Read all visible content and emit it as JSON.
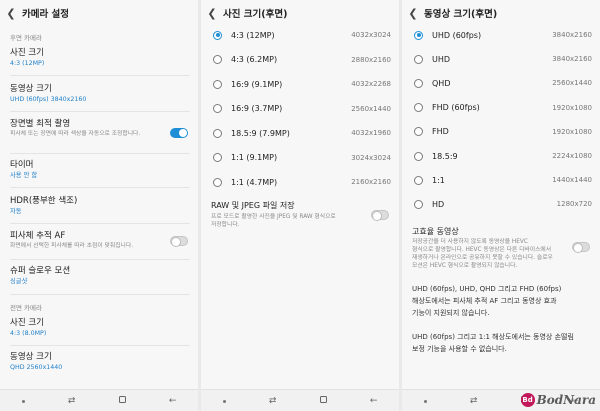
{
  "screen1": {
    "title": "카메라 설정",
    "rear_section": "후면 카메라",
    "front_section": "전면 카메라",
    "items": [
      {
        "title": "사진 크기",
        "sub": "4:3 (12MP)"
      },
      {
        "title": "동영상 크기",
        "sub": "UHD (60fps) 3840x2160"
      },
      {
        "title": "장면별 최적 촬영",
        "desc": "피사체 또는 장면에 따라 색상을 자동으로 조정합니다.",
        "toggle": true
      },
      {
        "title": "타이머",
        "sub": "사용 안 함"
      },
      {
        "title": "HDR(풍부한 색조)",
        "sub": "자동"
      },
      {
        "title": "피사체 추적 AF",
        "desc": "화면에서 선택한 피사체를 따라 초점이 맞춰집니다.",
        "toggle": false
      },
      {
        "title": "슈퍼 슬로우 모션",
        "sub": "싱글샷"
      }
    ],
    "front_items": [
      {
        "title": "사진 크기",
        "sub": "4:3 (8.0MP)"
      },
      {
        "title": "동영상 크기",
        "sub": "QHD 2560x1440"
      }
    ]
  },
  "screen2": {
    "title": "사진 크기(후면)",
    "options": [
      {
        "label": "4:3 (12MP)",
        "res": "4032x3024",
        "selected": true
      },
      {
        "label": "4:3 (6.2MP)",
        "res": "2880x2160",
        "selected": false
      },
      {
        "label": "16:9 (9.1MP)",
        "res": "4032x2268",
        "selected": false
      },
      {
        "label": "16:9 (3.7MP)",
        "res": "2560x1440",
        "selected": false
      },
      {
        "label": "18.5:9 (7.9MP)",
        "res": "4032x1960",
        "selected": false
      },
      {
        "label": "1:1 (9.1MP)",
        "res": "3024x3024",
        "selected": false
      },
      {
        "label": "1:1 (4.7MP)",
        "res": "2160x2160",
        "selected": false
      }
    ],
    "raw_title": "RAW 및 JPEG 파일 저장",
    "raw_desc_1": "프로 모드로 촬영한 사진을 JPEG 및 RAW 형식으로",
    "raw_desc_2": "저장합니다."
  },
  "screen3": {
    "title": "동영상 크기(후면)",
    "options": [
      {
        "label": "UHD (60fps)",
        "res": "3840x2160",
        "selected": true
      },
      {
        "label": "UHD",
        "res": "3840x2160",
        "selected": false
      },
      {
        "label": "QHD",
        "res": "2560x1440",
        "selected": false
      },
      {
        "label": "FHD (60fps)",
        "res": "1920x1080",
        "selected": false
      },
      {
        "label": "FHD",
        "res": "1920x1080",
        "selected": false
      },
      {
        "label": "18.5:9",
        "res": "2224x1080",
        "selected": false
      },
      {
        "label": "1:1",
        "res": "1440x1440",
        "selected": false
      },
      {
        "label": "HD",
        "res": "1280x720",
        "selected": false
      }
    ],
    "hevc_title": "고효율 동영상",
    "hevc_desc": [
      "저장공간을 더 사용하지 않도록 동영상을 HEVC",
      "형식으로 촬영합니다. HEVC 동영상은 다른 디바이스에서",
      "재생하거나 온라인으로 공유하지 못할 수 있습니다. 슬로우",
      "모션은 HEVC 형식으로 촬영되지 않습니다."
    ],
    "note1": [
      "UHD (60fps), UHD, QHD 그리고 FHD (60fps)",
      "해상도에서는 피사체 추적 AF 그리고 동영상 효과",
      "기능이 지원되지 않습니다."
    ],
    "note2": [
      "UHD (60fps) 그리고 1:1 해상도에서는 동영상 손떨림",
      "보정 기능을 사용할 수 없습니다."
    ]
  },
  "nav": {
    "recent": "⇄",
    "back": "←"
  },
  "watermark": {
    "badge": "Bd",
    "text": "BodNara"
  },
  "colors": {
    "accent": "#1e8fd6",
    "watermark": "#c2185b"
  }
}
